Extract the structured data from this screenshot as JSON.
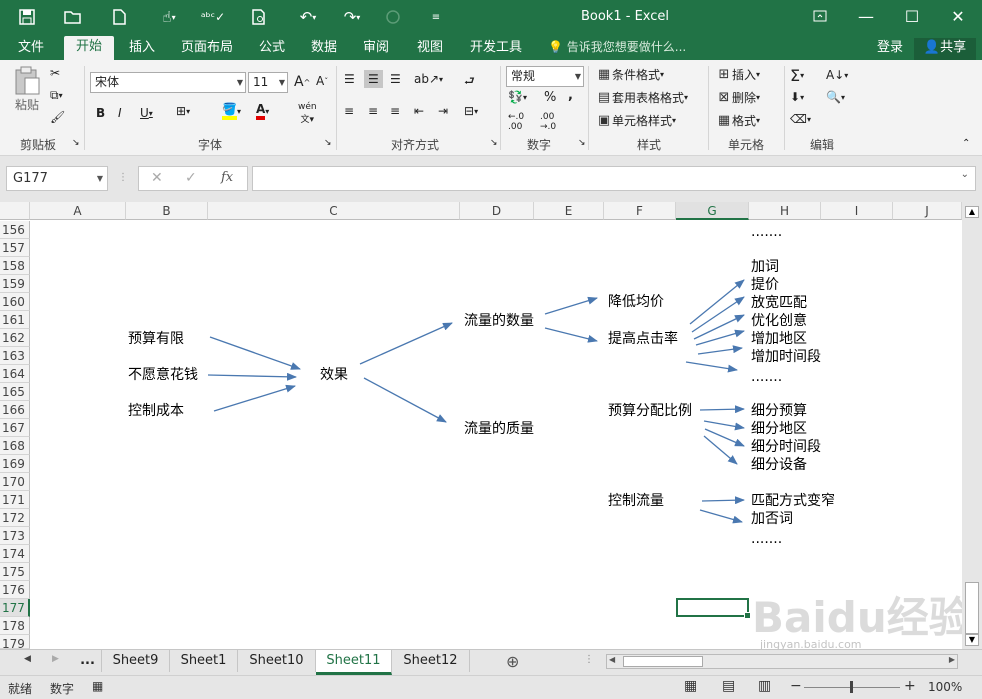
{
  "window": {
    "title": "Book1 - Excel",
    "restore_icon": "ribbon-display-icon",
    "minimize_icon": "minimize-icon",
    "maximize_icon": "maximize-icon",
    "close_icon": "close-icon"
  },
  "qat": [
    "save-icon",
    "open-icon",
    "new-icon",
    "touch-mode-icon",
    "spelling-icon",
    "print-preview-icon",
    "undo-icon",
    "redo-icon",
    "circle-icon",
    "customize-icon"
  ],
  "ribbon_tabs": [
    {
      "label": "文件",
      "active": false
    },
    {
      "label": "开始",
      "active": true
    },
    {
      "label": "插入",
      "active": false
    },
    {
      "label": "页面布局",
      "active": false
    },
    {
      "label": "公式",
      "active": false
    },
    {
      "label": "数据",
      "active": false
    },
    {
      "label": "审阅",
      "active": false
    },
    {
      "label": "视图",
      "active": false
    },
    {
      "label": "开发工具",
      "active": false
    }
  ],
  "tellme": "告诉我您想要做什么...",
  "login": "登录",
  "share": "共享",
  "ribbon": {
    "clipboard": {
      "label": "剪贴板",
      "paste": "粘贴"
    },
    "font": {
      "label": "字体",
      "name": "宋体",
      "size": "11",
      "wen": "wén"
    },
    "alignment": {
      "label": "对齐方式"
    },
    "number": {
      "label": "数字",
      "format": "常规"
    },
    "styles": {
      "label": "样式",
      "cond": "条件格式",
      "table": "套用表格格式",
      "cell": "单元格样式"
    },
    "cells": {
      "label": "单元格",
      "insert": "插入",
      "delete": "删除",
      "format": "格式"
    },
    "editing": {
      "label": "编辑"
    }
  },
  "formula_bar": {
    "namebox": "G177",
    "fx": "fx",
    "value": ""
  },
  "columns": [
    "A",
    "B",
    "C",
    "D",
    "E",
    "F",
    "G",
    "H",
    "I",
    "J"
  ],
  "selected_column": "G",
  "rows": [
    "156",
    "157",
    "158",
    "159",
    "160",
    "161",
    "162",
    "163",
    "164",
    "165",
    "166",
    "167",
    "168",
    "169",
    "170",
    "171",
    "172",
    "173",
    "174",
    "175",
    "176",
    "177",
    "178",
    "179"
  ],
  "selected_row": "177",
  "cells": {
    "r156_h": ".......",
    "r158_h": "加词",
    "r159_h": "提价",
    "r160_f": "降低均价",
    "r160_h": "放宽匹配",
    "r161_d": "流量的数量",
    "r161_h": "优化创意",
    "r162_b": "预算有限",
    "r162_f": "提高点击率",
    "r162_h": "增加地区",
    "r163_h": "增加时间段",
    "r164_b": "不愿意花钱",
    "r164_c": "效果",
    "r165_h": ".......",
    "r166_b": "控制成本",
    "r166_f": "预算分配比例",
    "r166_h": "细分预算",
    "r167_d": "流量的质量",
    "r167_h": "细分地区",
    "r168_h": "细分时间段",
    "r169_h": "细分设备",
    "r171_f": "控制流量",
    "r171_h": "匹配方式变窄",
    "r172_h": "加否词",
    "r173_h": "......."
  },
  "sheets": [
    {
      "label": "...",
      "active": false
    },
    {
      "label": "Sheet9",
      "active": false
    },
    {
      "label": "Sheet1",
      "active": false
    },
    {
      "label": "Sheet10",
      "active": false
    },
    {
      "label": "Sheet11",
      "active": true
    },
    {
      "label": "Sheet12",
      "active": false
    }
  ],
  "status": {
    "ready": "就绪",
    "mode": "数字",
    "zoom": "100%"
  },
  "watermark": {
    "main": "Baidu经验",
    "sub": "jingyan.baidu.com"
  },
  "colors": {
    "brand": "#217346",
    "arrow": "#4a78b0"
  }
}
